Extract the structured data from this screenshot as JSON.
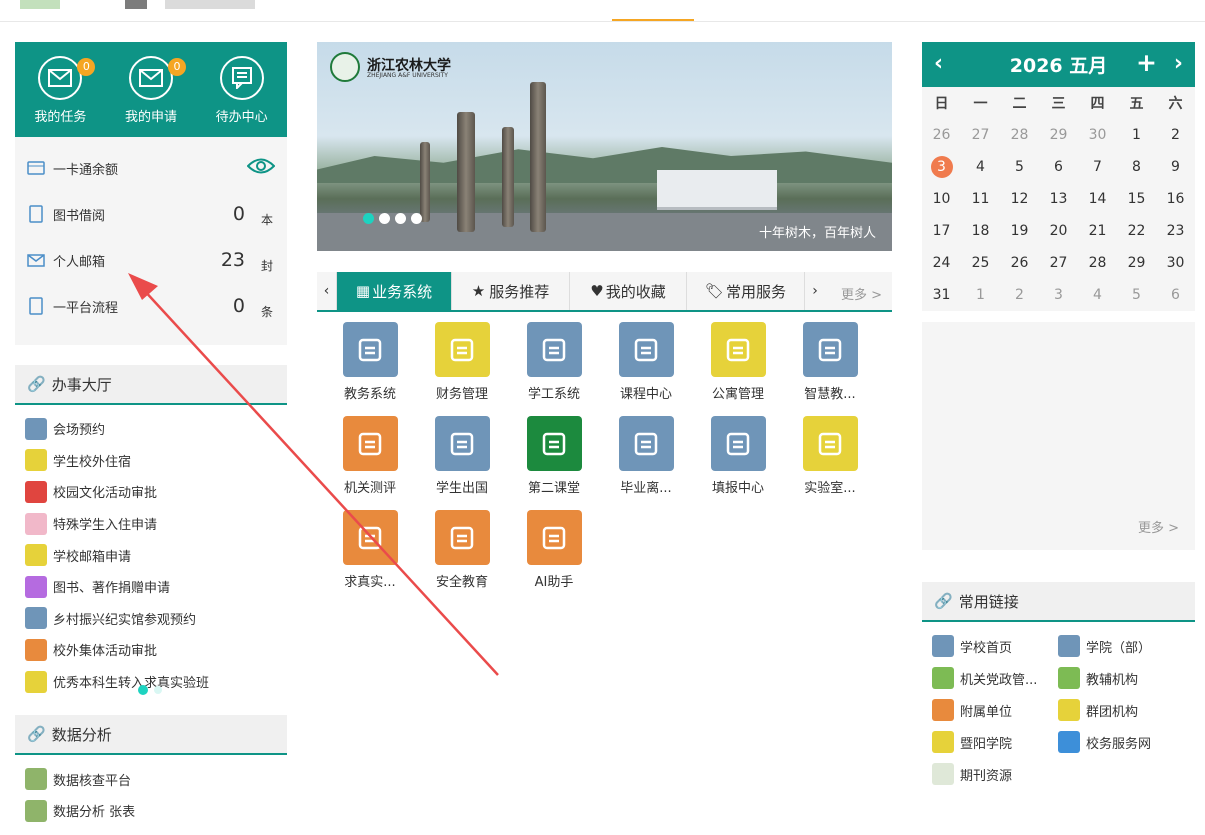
{
  "quick_actions": [
    {
      "label": "我的任务",
      "badge": "0"
    },
    {
      "label": "我的申请",
      "badge": "0"
    },
    {
      "label": "待办中心"
    }
  ],
  "stats": [
    {
      "label": "一卡通余额"
    },
    {
      "label": "图书借阅",
      "value": "0",
      "unit": "本"
    },
    {
      "label": "个人邮箱",
      "value": "23",
      "unit": "封"
    },
    {
      "label": "一平台流程",
      "value": "0",
      "unit": "条"
    }
  ],
  "office": {
    "title": "办事大厅",
    "items": [
      "会场预约",
      "学生校外住宿",
      "校园文化活动审批",
      "特殊学生入住申请",
      "学校邮箱申请",
      "图书、著作捐赠申请",
      "乡村振兴纪实馆参观预约",
      "校外集体活动审批",
      "优秀本科生转入求真实验班"
    ]
  },
  "analysis": {
    "title": "数据分析",
    "items": [
      "数据核查平台",
      "数据分析 张表"
    ]
  },
  "banner": {
    "logo": "浙江农林大学",
    "logo_en": "ZHEJIANG A&F UNIVERSITY",
    "caption": "十年树木，百年树人"
  },
  "tabs": [
    "业务系统",
    "服务推荐",
    "我的收藏",
    "常用服务"
  ],
  "tabs_more": "更多 >",
  "apps": [
    {
      "name": "教务系统",
      "color": "#6f95b8"
    },
    {
      "name": "财务管理",
      "color": "#e6d23a"
    },
    {
      "name": "学工系统",
      "color": "#6f95b8"
    },
    {
      "name": "课程中心",
      "color": "#6f95b8"
    },
    {
      "name": "公寓管理",
      "color": "#e6d23a"
    },
    {
      "name": "智慧教...",
      "color": "#6f95b8"
    },
    {
      "name": "机关测评",
      "color": "#e88a3d"
    },
    {
      "name": "学生出国",
      "color": "#6f95b8"
    },
    {
      "name": "第二课堂",
      "color": "#1c8a3e"
    },
    {
      "name": "毕业离...",
      "color": "#6f95b8"
    },
    {
      "name": "填报中心",
      "color": "#6f95b8"
    },
    {
      "name": "实验室...",
      "color": "#e6d23a"
    },
    {
      "name": "求真实...",
      "color": "#e88a3d"
    },
    {
      "name": "安全教育",
      "color": "#e88a3d"
    },
    {
      "name": "AI助手",
      "color": "#e88a3d"
    }
  ],
  "calendar": {
    "title": "2026 五月",
    "dow": [
      "日",
      "一",
      "二",
      "三",
      "四",
      "五",
      "六"
    ],
    "days": [
      "26",
      "27",
      "28",
      "29",
      "30",
      "1",
      "2",
      "3",
      "4",
      "5",
      "6",
      "7",
      "8",
      "9",
      "10",
      "11",
      "12",
      "13",
      "14",
      "15",
      "16",
      "17",
      "18",
      "19",
      "20",
      "21",
      "22",
      "23",
      "24",
      "25",
      "26",
      "27",
      "28",
      "29",
      "30",
      "31",
      "1",
      "2",
      "3",
      "4",
      "5",
      "6"
    ],
    "today": "3",
    "events_more": "更多 >"
  },
  "links": {
    "title": "常用链接",
    "items": [
      {
        "label": "学校首页",
        "color": "#6f95b8"
      },
      {
        "label": "学院（部）",
        "color": "#6f95b8"
      },
      {
        "label": "机关党政管...",
        "color": "#7dbb54"
      },
      {
        "label": "教辅机构",
        "color": "#7dbb54"
      },
      {
        "label": "附属单位",
        "color": "#e88a3d"
      },
      {
        "label": "群团机构",
        "color": "#e6d23a"
      },
      {
        "label": "暨阳学院",
        "color": "#e6d23a"
      },
      {
        "label": "校务服务网",
        "color": "#3d8fd9"
      },
      {
        "label": "期刊资源",
        "color": "#dfe8d8"
      }
    ]
  },
  "colors": {
    "teal": "#0e9486",
    "orange": "#f5a623",
    "today": "#f07b4e",
    "arrow": "#ea4b4b"
  }
}
